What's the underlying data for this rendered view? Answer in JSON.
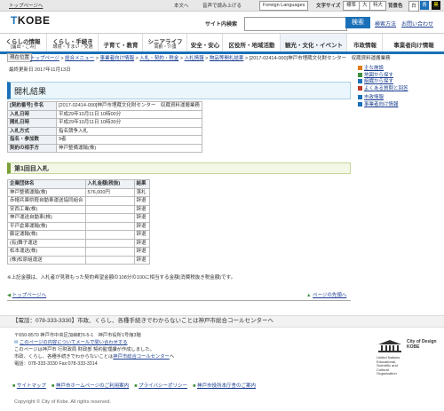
{
  "topbar": {
    "top_link": "トップページへ",
    "honbun": "本文へ",
    "voice": "音声で読み上げる",
    "language": "Foreign Languages",
    "font_size": "文字サイズ",
    "standard": "標準",
    "large": "大",
    "xlarge": "特大",
    "bg_color": "背景色",
    "white": "白",
    "blue": "青",
    "black": "黒"
  },
  "header": {
    "logo": "KOBE",
    "search_label": "サイト内検索",
    "search_placeholder": "",
    "search_button": "検索",
    "search_method": "検索方法",
    "inquiry": "お問い合わせ"
  },
  "nav": [
    {
      "label": "くらしの情報",
      "sub": "[届出・ごみ]"
    },
    {
      "label": "くらし・手続き",
      "sub": "環境・すまい・交通"
    },
    {
      "label": "子育て・教育",
      "sub": ""
    },
    {
      "label": "シニアライフ",
      "sub": "高齢・介護"
    },
    {
      "label": "安全・安心",
      "sub": ""
    },
    {
      "label": "区役所・地域活動",
      "sub": ""
    },
    {
      "label": "観光・文化・イベント",
      "sub": ""
    },
    {
      "label": "市政情報",
      "sub": ""
    },
    {
      "label": "事業者向け情報",
      "sub": ""
    }
  ],
  "breadcrumb": {
    "label": "現在位置",
    "items": [
      "トップページ",
      "総合メニュー",
      "事業者向け情報",
      "入札・契約・税金",
      "入札情報",
      "物品等開札結果"
    ],
    "current": "[2017-02414-000]神戸市埋蔵文化財センター　収蔵資料運搬業務"
  },
  "updated": "最終更新日 2017年11月13日",
  "sidebar": [
    {
      "label": "主な施設",
      "color": "#e07b1a"
    },
    {
      "label": "地図から探す",
      "color": "#3d8f3d"
    },
    {
      "label": "組織から探す",
      "color": "#1a70b8"
    },
    {
      "label": "よくある質問と回答",
      "color": "#c0392b"
    },
    {
      "label": "市政情報",
      "color": "#1a70b8"
    },
    {
      "label": "事業者向け情報",
      "color": "#1a70b8"
    }
  ],
  "page_title": "開札結果",
  "info_table": [
    {
      "h": "[契約番号] 件名",
      "v": "[2017-02414-000]神戸市埋蔵文化財センター　収蔵資料運搬業務"
    },
    {
      "h": "入札日時",
      "v": "平成29年10月11日 10時00分"
    },
    {
      "h": "開札日時",
      "v": "平成29年10月11日 10時30分"
    },
    {
      "h": "入札方式",
      "v": "指名競争入札"
    },
    {
      "h": "指名・参加数",
      "v": "9者"
    },
    {
      "h": "契約の相手方",
      "v": "神戸整備運輸(株)"
    }
  ],
  "round_title": "第1回目入札",
  "bid_table": {
    "headers": [
      "企業団体名",
      "入札金額(税抜)",
      "結果"
    ],
    "rows": [
      [
        "神戸整備運輸(株)",
        "576,000円",
        "落札"
      ],
      [
        "赤帽兵庫県軽自動車運送協同組合",
        "",
        "辞退"
      ],
      [
        "安西工業(株)",
        "",
        "辞退"
      ],
      [
        "神戸運送自動車(株)",
        "",
        "辞退"
      ],
      [
        "平戸倉庫運輸(株)",
        "",
        "辞退"
      ],
      [
        "藤定運輸(株)",
        "",
        "辞退"
      ],
      [
        "(有)舞子運送",
        "",
        "辞退"
      ],
      [
        "松本運送(株)",
        "",
        "辞退"
      ],
      [
        "(株)松原組運送",
        "",
        "辞退"
      ]
    ]
  },
  "note": "※上記金額は、入札者が見積もった契約希望金額の108分の100に相当する金額(消費税抜き税金額)です。",
  "pagenav": {
    "top": "トップページへ",
    "up": "ページの先頭へ"
  },
  "tel_bar": "【電話：078-333-3330】市政、くらし、各種手続きでわからないことは神戸市総合コールセンターへ",
  "footer": {
    "address": "〒650-8570 神戸市中央区加納町6-5-1　神戸市役所1号館3階",
    "mail_link": "このページの内容についてメールで問い合わせする",
    "dept": "このページは神戸市 行財政局 財政部 契約監理課が作成しました。",
    "call_prefix": "市政、くらし、各種手続きでわからないことは",
    "call_link": "神戸市総合コールセンター",
    "call_suffix": "へ",
    "phone": "電話：078-333-3330 Fax:078-333-3314",
    "unesco_title": "City of Design KOBE",
    "unesco_org": "United Nations Educational, Scientific and Cultural Organization"
  },
  "footlinks": [
    "サイトマップ",
    "神戸市ホームページのご利用案内",
    "プライバシーポリシー",
    "神戸市役所本庁舎のご案内"
  ],
  "copyright": "Copyright © City of Kobe. All rights reserved."
}
